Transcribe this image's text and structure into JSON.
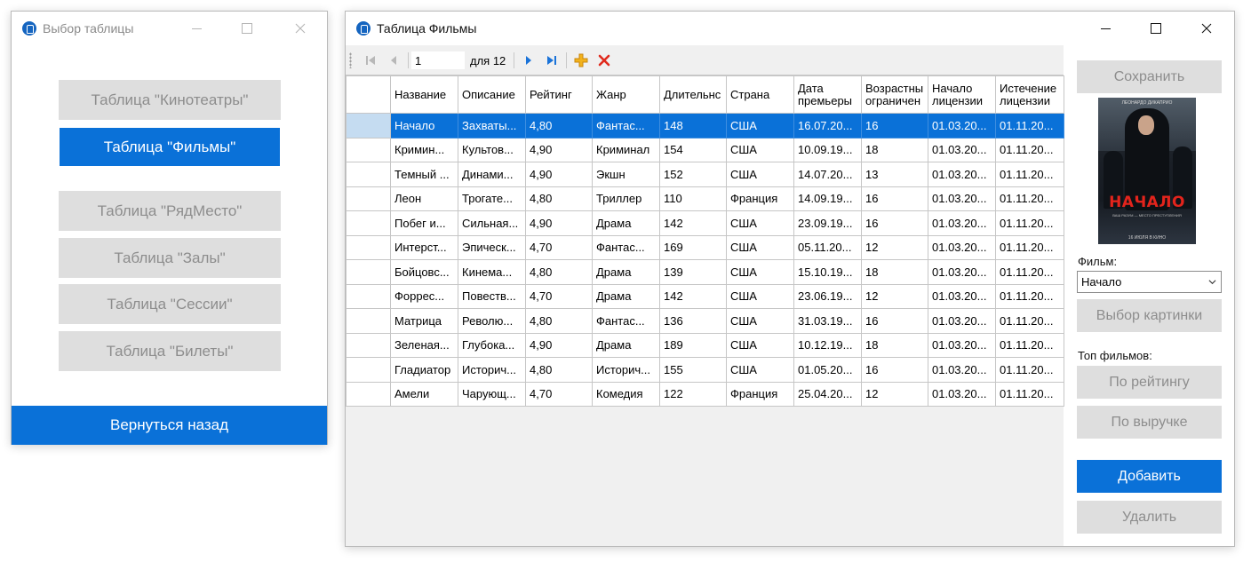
{
  "window1": {
    "title": "Выбор таблицы",
    "buttons": {
      "cinemas": "Таблица \"Кинотеатры\"",
      "films": "Таблица \"Фильмы\"",
      "rowseat": "Таблица \"РядМесто\"",
      "halls": "Таблица \"Залы\"",
      "sessions": "Таблица \"Сессии\"",
      "tickets": "Таблица \"Билеты\""
    },
    "back": "Вернуться назад"
  },
  "window2": {
    "title": "Таблица Фильмы",
    "navigator": {
      "position": "1",
      "count_label": "для 12"
    },
    "columns": [
      "Название",
      "Описание",
      "Рейтинг",
      "Жанр",
      "Длительность",
      "Страна",
      "Дата премьеры",
      "Возрастные ограничения",
      "Начало лицензии",
      "Истечение лицензии"
    ],
    "columns_display": [
      "Название",
      "Описание",
      "Рейтинг",
      "Жанр",
      "Длительнс",
      "Страна",
      "Дата премьеры",
      "Возрастны ограничен",
      "Начало лицензии",
      "Истечение лицензии"
    ],
    "rows": [
      [
        "Начало",
        "Захваты...",
        "4,80",
        "Фантас...",
        "148",
        "США",
        "16.07.20...",
        "16",
        "01.03.20...",
        "01.11.20..."
      ],
      [
        "Кримин...",
        "Культов...",
        "4,90",
        "Криминал",
        "154",
        "США",
        "10.09.19...",
        "18",
        "01.03.20...",
        "01.11.20..."
      ],
      [
        "Темный ...",
        "Динами...",
        "4,90",
        "Экшн",
        "152",
        "США",
        "14.07.20...",
        "13",
        "01.03.20...",
        "01.11.20..."
      ],
      [
        "Леон",
        "Трогате...",
        "4,80",
        "Триллер",
        "110",
        "Франция",
        "14.09.19...",
        "16",
        "01.03.20...",
        "01.11.20..."
      ],
      [
        "Побег и...",
        "Сильная...",
        "4,90",
        "Драма",
        "142",
        "США",
        "23.09.19...",
        "16",
        "01.03.20...",
        "01.11.20..."
      ],
      [
        "Интерст...",
        "Эпическ...",
        "4,70",
        "Фантас...",
        "169",
        "США",
        "05.11.20...",
        "12",
        "01.03.20...",
        "01.11.20..."
      ],
      [
        "Бойцовс...",
        "Кинема...",
        "4,80",
        "Драма",
        "139",
        "США",
        "15.10.19...",
        "18",
        "01.03.20...",
        "01.11.20..."
      ],
      [
        "Форрес...",
        "Повеств...",
        "4,70",
        "Драма",
        "142",
        "США",
        "23.06.19...",
        "12",
        "01.03.20...",
        "01.11.20..."
      ],
      [
        "Матрица",
        "Револю...",
        "4,80",
        "Фантас...",
        "136",
        "США",
        "31.03.19...",
        "16",
        "01.03.20...",
        "01.11.20..."
      ],
      [
        "Зеленая...",
        "Глубока...",
        "4,90",
        "Драма",
        "189",
        "США",
        "10.12.19...",
        "18",
        "01.03.20...",
        "01.11.20..."
      ],
      [
        "Гладиатор",
        "Историч...",
        "4,80",
        "Историч...",
        "155",
        "США",
        "01.05.20...",
        "16",
        "01.03.20...",
        "01.11.20..."
      ],
      [
        "Амели",
        "Чарующ...",
        "4,70",
        "Комедия",
        "122",
        "Франция",
        "25.04.20...",
        "12",
        "01.03.20...",
        "01.11.20..."
      ]
    ],
    "selected_row": 0,
    "side": {
      "save": "Сохранить",
      "poster": {
        "top": "ЛЕОНАРДО ДИКАПРИО",
        "title": "НАЧАЛО",
        "sub": "ВАШ РАЗУМ — МЕСТО ПРЕСТУПЛЕНИЯ",
        "bottom": "16 ИЮЛЯ В КИНО"
      },
      "film_label": "Фильм:",
      "film_value": "Начало",
      "choose_picture": "Выбор картинки",
      "top_label": "Топ фильмов:",
      "by_rating": "По рейтингу",
      "by_revenue": "По выручке",
      "add": "Добавить",
      "delete": "Удалить"
    }
  },
  "colors": {
    "accent": "#0a71d8",
    "disabled_bg": "#dedede",
    "disabled_text": "#8d8d8d"
  }
}
